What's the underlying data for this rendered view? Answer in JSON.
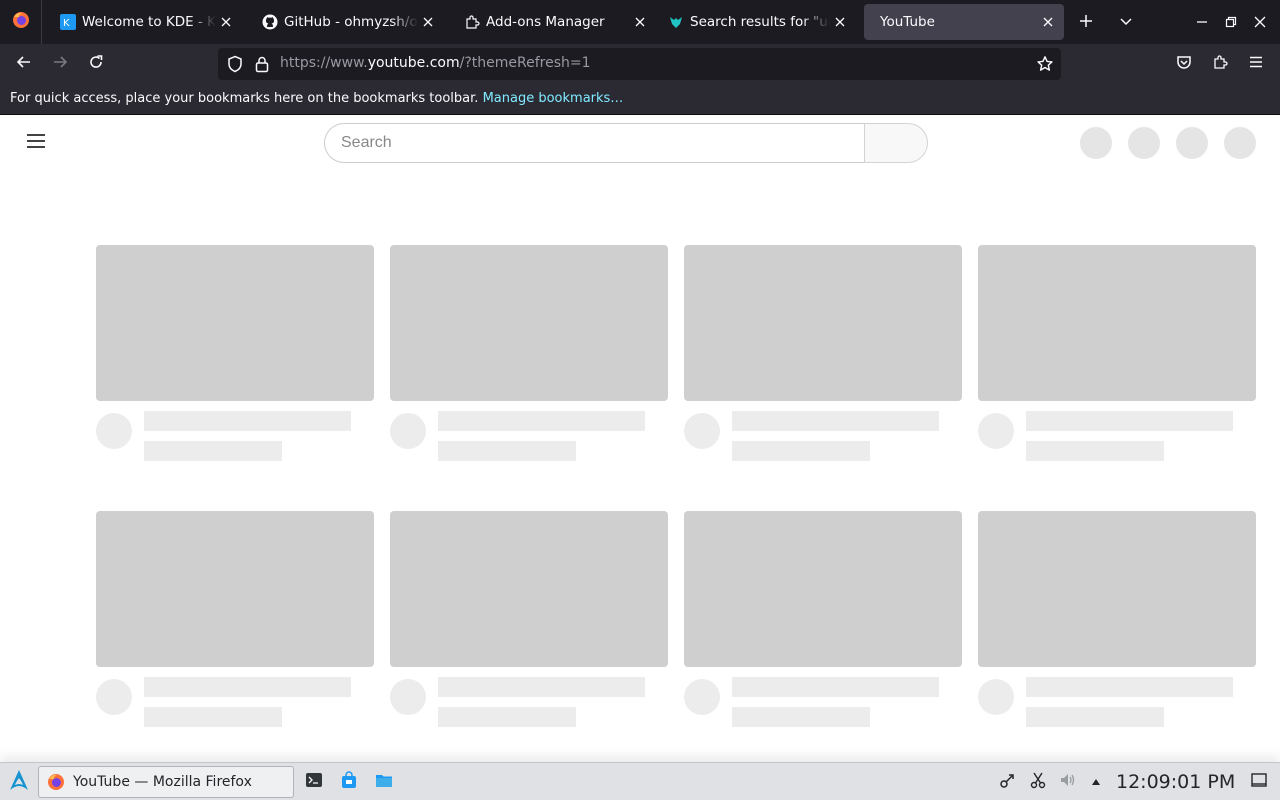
{
  "browser": {
    "tabs": [
      {
        "title": "Welcome to KDE - KDE Community",
        "icon": "kde-icon",
        "active": false
      },
      {
        "title": "GitHub - ohmyzsh/ohmyzsh",
        "icon": "github-icon",
        "active": false
      },
      {
        "title": "Add-ons Manager",
        "icon": "puzzle-icon",
        "active": false
      },
      {
        "title": "Search results for \"ublock origin\"",
        "icon": "addon-search-icon",
        "active": false
      },
      {
        "title": "YouTube",
        "icon": "",
        "active": true
      }
    ],
    "url_prefix": "https://www.",
    "url_host": "youtube.com",
    "url_suffix": "/?themeRefresh=1",
    "bookmarks_message": "For quick access, place your bookmarks here on the bookmarks toolbar.",
    "bookmarks_link": "Manage bookmarks…"
  },
  "youtube": {
    "search_placeholder": "Search"
  },
  "taskbar": {
    "window_title": "YouTube — Mozilla Firefox",
    "clock": "12:09:01 PM"
  },
  "colors": {
    "tab_strip": "#1c1b22",
    "toolbar": "#2b2a33",
    "link": "#80ebff",
    "skeleton_thumb": "#cfcfcf",
    "skeleton_text": "#ececec",
    "panel": "#dfe1e4"
  }
}
